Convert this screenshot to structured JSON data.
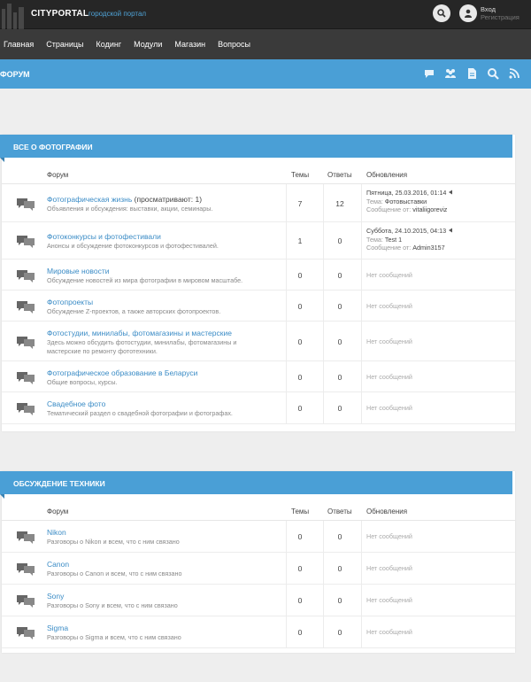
{
  "top": {
    "brand": "CITYPORTAL",
    "tagline": "городской портал",
    "login": "Вход",
    "register": "Регистрация"
  },
  "nav": [
    "Главная",
    "Страницы",
    "Кодинг",
    "Модули",
    "Магазин",
    "Вопросы"
  ],
  "section": {
    "title": "ФОРУМ"
  },
  "columns": {
    "forum": "Форум",
    "topics": "Темы",
    "replies": "Ответы",
    "updates": "Обновления"
  },
  "panels": [
    {
      "title": "ВСЕ О ФОТОГРАФИИ",
      "rows": [
        {
          "title": "Фотографическая жизнь",
          "extra": " (просматривают: 1)",
          "desc": "Объявления и обсуждения: выставки, акции, семинары.",
          "topics": "7",
          "replies": "12",
          "last": {
            "date": "Пятница, 25.03.2016, 01:14",
            "topic_label": "Тема:",
            "topic": "Фотовыставки",
            "author_label": "Сообщение от:",
            "author": "vitaliigoreviz"
          }
        },
        {
          "title": "Фотоконкурсы и фотофестивали",
          "extra": "",
          "desc": "Анонсы и обсуждение фотоконкурсов и фотофестивалей.",
          "topics": "1",
          "replies": "0",
          "last": {
            "date": "Суббота, 24.10.2015, 04:13",
            "topic_label": "Тема:",
            "topic": "Test 1",
            "author_label": "Сообщение от:",
            "author": "Admin3157"
          }
        },
        {
          "title": "Мировые новости",
          "extra": "",
          "desc": "Обсуждение новостей из мира фотографии в мировом масштабе.",
          "topics": "0",
          "replies": "0",
          "none": "Нет сообщений"
        },
        {
          "title": "Фотопроекты",
          "extra": "",
          "desc": "Обсуждение Z-проектов, а также авторских фотопроектов.",
          "topics": "0",
          "replies": "0",
          "none": "Нет сообщений"
        },
        {
          "title": "Фотостудии, минилабы, фотомагазины и мастерские",
          "extra": "",
          "desc": "Здесь можно обсудить фотостудии, минилабы, фотомагазины и мастерские по ремонту фототехники.",
          "topics": "0",
          "replies": "0",
          "none": "Нет сообщений"
        },
        {
          "title": "Фотографическое образование в Беларуси",
          "extra": "",
          "desc": "Общие вопросы, курсы.",
          "topics": "0",
          "replies": "0",
          "none": "Нет сообщений"
        },
        {
          "title": "Свадебное фото",
          "extra": "",
          "desc": "Тематический раздел о свадебной фотографии и фотографах.",
          "topics": "0",
          "replies": "0",
          "none": "Нет сообщений"
        }
      ]
    },
    {
      "title": "ОБСУЖДЕНИЕ ТЕХНИКИ",
      "rows": [
        {
          "title": "Nikon",
          "extra": "",
          "desc": "Разговоры о Nikon и всем, что с ним связано",
          "topics": "0",
          "replies": "0",
          "none": "Нет сообщений"
        },
        {
          "title": "Canon",
          "extra": "",
          "desc": "Разговоры о Canon и всем, что с ним связано",
          "topics": "0",
          "replies": "0",
          "none": "Нет сообщений"
        },
        {
          "title": "Sony",
          "extra": "",
          "desc": "Разговоры о Sony и всем, что с ним связано",
          "topics": "0",
          "replies": "0",
          "none": "Нет сообщений"
        },
        {
          "title": "Sigma",
          "extra": "",
          "desc": "Разговоры о Sigma и всем, что с ним связано",
          "topics": "0",
          "replies": "0",
          "none": "Нет сообщений"
        }
      ]
    }
  ],
  "colors": {
    "accent": "#4a9fd6",
    "link": "#3b8cc6",
    "topbar": "#262626",
    "navbar": "#3a3a3a"
  }
}
